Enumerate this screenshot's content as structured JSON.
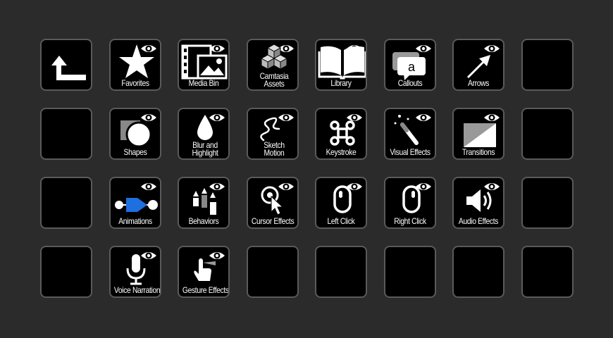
{
  "keys": {
    "back": {
      "label": "",
      "icon": "back-arrow-icon"
    },
    "favorites": {
      "label": "Favorites",
      "icon": "star-icon"
    },
    "media_bin": {
      "label": "Media Bin",
      "icon": "film-image-icon"
    },
    "camtasia_assets": {
      "label": "Camtasia Assets",
      "icon": "cubes-icon"
    },
    "library": {
      "label": "Library",
      "icon": "book-icon"
    },
    "callouts": {
      "label": "Callouts",
      "icon": "speech-bubble-icon"
    },
    "arrows": {
      "label": "Arrows",
      "icon": "arrow-icon"
    },
    "shapes": {
      "label": "Shapes",
      "icon": "shapes-icon"
    },
    "blur_highlight": {
      "label": "Blur and Highlight",
      "icon": "droplet-icon"
    },
    "sketch_motion": {
      "label": "Sketch Motion",
      "icon": "squiggle-icon"
    },
    "keystroke": {
      "label": "Keystroke",
      "icon": "command-key-icon"
    },
    "visual_effects": {
      "label": "Visual Effects",
      "icon": "magic-wand-icon"
    },
    "transitions": {
      "label": "Transitions",
      "icon": "transition-icon"
    },
    "animations": {
      "label": "Animations",
      "icon": "animation-icon"
    },
    "behaviors": {
      "label": "Behaviors",
      "icon": "behaviors-icon"
    },
    "cursor_effects": {
      "label": "Cursor Effects",
      "icon": "cursor-click-icon"
    },
    "left_click": {
      "label": "Left Click",
      "icon": "mouse-left-icon"
    },
    "right_click": {
      "label": "Right Click",
      "icon": "mouse-right-icon"
    },
    "audio_effects": {
      "label": "Audio Effects",
      "icon": "speaker-icon"
    },
    "voice_narration": {
      "label": "Voice Narration",
      "icon": "microphone-icon"
    },
    "gesture_effects": {
      "label": "Gesture Effects",
      "icon": "hand-gesture-icon"
    }
  },
  "colors": {
    "background": "#2b2b2b",
    "key": "#000000",
    "border": "#5a5a5a",
    "accent_blue": "#1e6fe0"
  }
}
